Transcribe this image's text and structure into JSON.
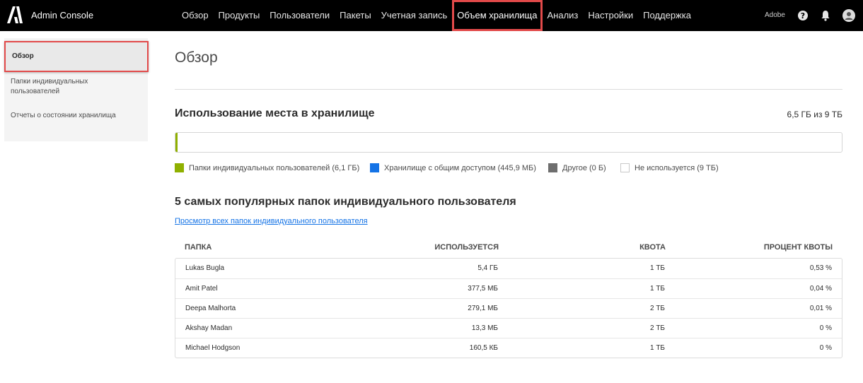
{
  "app": {
    "title": "Admin Console",
    "org": "Adobe"
  },
  "nav": {
    "items": [
      {
        "label": "Обзор"
      },
      {
        "label": "Продукты"
      },
      {
        "label": "Пользователи"
      },
      {
        "label": "Пакеты"
      },
      {
        "label": "Учетная запись"
      },
      {
        "label": "Объем хранилища",
        "active": true
      },
      {
        "label": "Анализ"
      },
      {
        "label": "Настройки"
      },
      {
        "label": "Поддержка"
      }
    ]
  },
  "icons": {
    "logo": "adobe-logo",
    "help": "help-icon",
    "bell": "bell-icon",
    "avatar": "user-avatar-icon"
  },
  "sidebar": {
    "items": [
      {
        "label": "Обзор",
        "active": true
      },
      {
        "label": "Папки индивидуальных пользователей"
      },
      {
        "label": "Отчеты о состоянии хранилища"
      }
    ]
  },
  "main": {
    "page_title": "Обзор",
    "usage": {
      "title": "Использование места в хранилище",
      "total": "6,5 ГБ из 9 ТБ",
      "legend": [
        {
          "label": "Папки индивидуальных пользователей (6,1 ГБ)",
          "color": "#8fb000"
        },
        {
          "label": "Хранилище с общим доступом (445,9 МБ)",
          "color": "#1473e6"
        },
        {
          "label": "Другое (0 Б)",
          "color": "#6e6e6e"
        },
        {
          "label": "Не используется (9 ТБ)",
          "color": "#ffffff"
        }
      ]
    },
    "top5": {
      "title": "5 самых популярных папок индивидуального пользователя",
      "view_all": "Просмотр всех папок индивидуального пользователя",
      "columns": {
        "folder": "ПАПКА",
        "used": "ИСПОЛЬЗУЕТСЯ",
        "quota": "КВОТА",
        "pct": "ПРОЦЕНТ КВОТЫ"
      },
      "rows": [
        {
          "folder": "Lukas Bugla",
          "used": "5,4 ГБ",
          "quota": "1 ТБ",
          "pct": "0,53 %"
        },
        {
          "folder": "Amit Patel",
          "used": "377,5 МБ",
          "quota": "1 ТБ",
          "pct": "0,04 %"
        },
        {
          "folder": "Deepa Malhorta",
          "used": "279,1 МБ",
          "quota": "2 ТБ",
          "pct": "0,01 %"
        },
        {
          "folder": "Akshay Madan",
          "used": "13,3 МБ",
          "quota": "2 ТБ",
          "pct": "0 %"
        },
        {
          "folder": "Michael Hodgson",
          "used": "160,5 КБ",
          "quota": "1 ТБ",
          "pct": "0 %"
        }
      ]
    }
  }
}
